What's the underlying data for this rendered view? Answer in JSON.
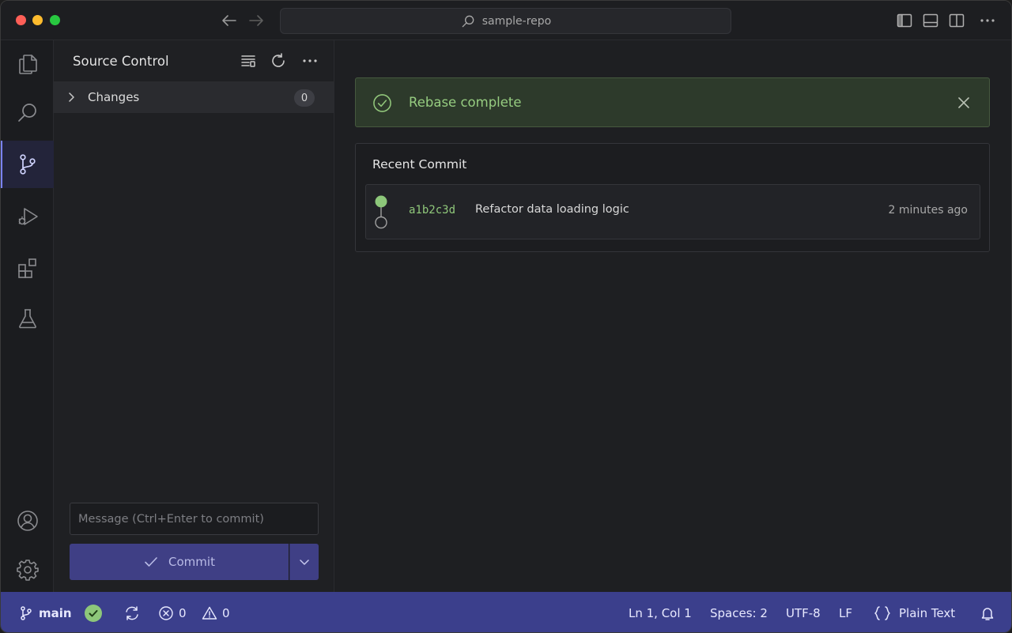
{
  "titlebar": {
    "search_text": "sample-repo"
  },
  "sidebar": {
    "title": "Source Control",
    "changes_label": "Changes",
    "changes_count": "0",
    "message_placeholder": "Message (Ctrl+Enter to commit)",
    "commit_label": "Commit"
  },
  "notification": {
    "text": "Rebase complete"
  },
  "recent_commit": {
    "title": "Recent Commit",
    "hash": "a1b2c3d",
    "message": "Refactor data loading logic",
    "time": "2 minutes ago"
  },
  "statusbar": {
    "branch": "main",
    "errors": "0",
    "warnings": "0",
    "position": "Ln 1, Col 1",
    "spaces": "Spaces: 2",
    "encoding": "UTF-8",
    "eol": "LF",
    "language": "Plain Text"
  },
  "colors": {
    "accent": "#7b83ff",
    "statusbar": "#3b3f8c",
    "success": "#92c77b",
    "commit_button": "#3f3f85"
  },
  "icons": {
    "activity": [
      "files-icon",
      "search-icon",
      "source-control-icon",
      "run-debug-icon",
      "extensions-icon",
      "testing-icon",
      "account-icon",
      "settings-gear-icon"
    ]
  }
}
